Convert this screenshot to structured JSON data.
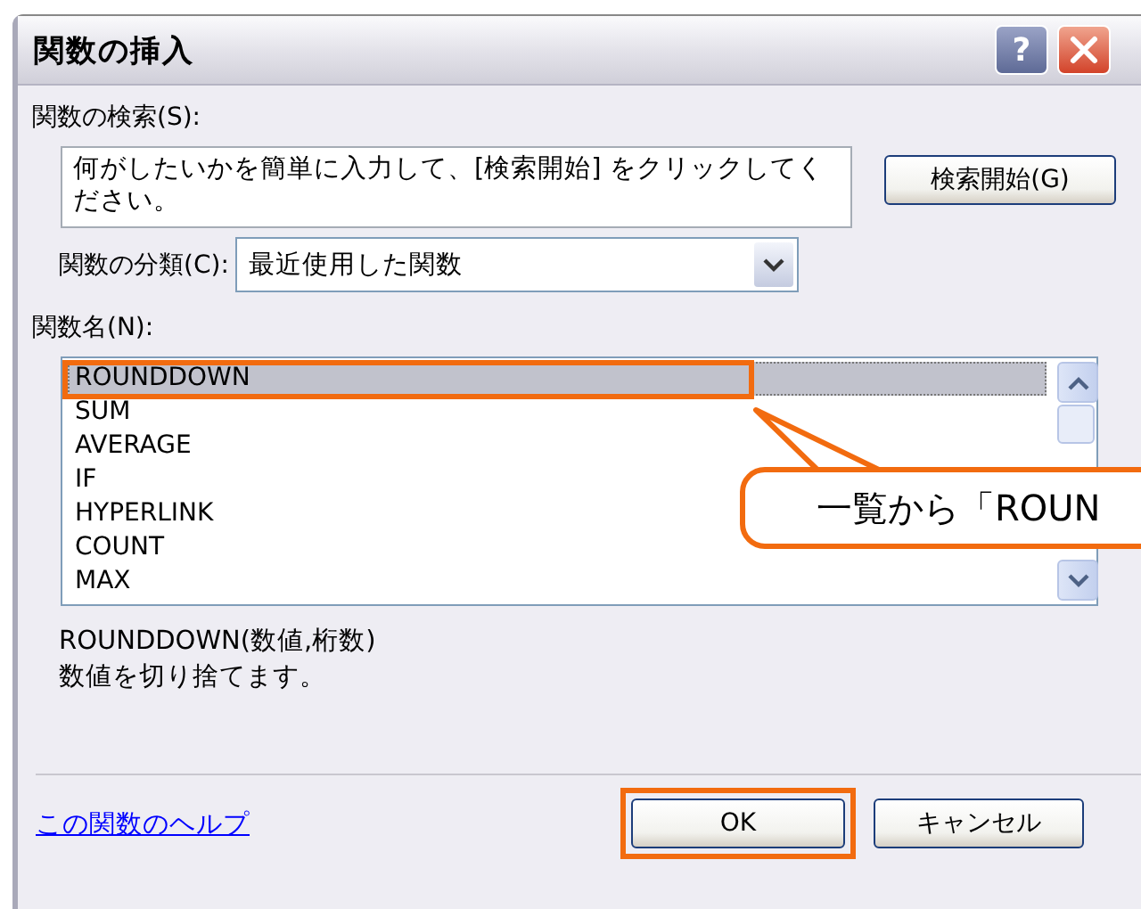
{
  "window": {
    "title": "関数の挿入",
    "help_button": "?"
  },
  "search": {
    "label": "関数の検索(S):",
    "value": "何がしたいかを簡単に入力して、[検索開始] をクリックしてください。",
    "button": "検索開始(G)"
  },
  "category": {
    "label": "関数の分類(C):",
    "value": "最近使用した関数"
  },
  "functions": {
    "label": "関数名(N):",
    "items": [
      {
        "name": "ROUNDDOWN",
        "selected": true,
        "annotated": true
      },
      {
        "name": "SUM",
        "selected": false,
        "annotated": false
      },
      {
        "name": "AVERAGE",
        "selected": false,
        "annotated": false
      },
      {
        "name": "IF",
        "selected": false,
        "annotated": false
      },
      {
        "name": "HYPERLINK",
        "selected": false,
        "annotated": false
      },
      {
        "name": "COUNT",
        "selected": false,
        "annotated": false
      },
      {
        "name": "MAX",
        "selected": false,
        "annotated": false
      }
    ]
  },
  "description": {
    "syntax": "ROUNDDOWN(数値,桁数)",
    "text": "数値を切り捨てます。"
  },
  "help_link": "この関数のヘルプ",
  "buttons": [
    {
      "label": "OK",
      "annotated": true
    },
    {
      "label": "キャンセル",
      "annotated": false
    }
  ],
  "callout": {
    "text": "一覧から「ROUN"
  }
}
